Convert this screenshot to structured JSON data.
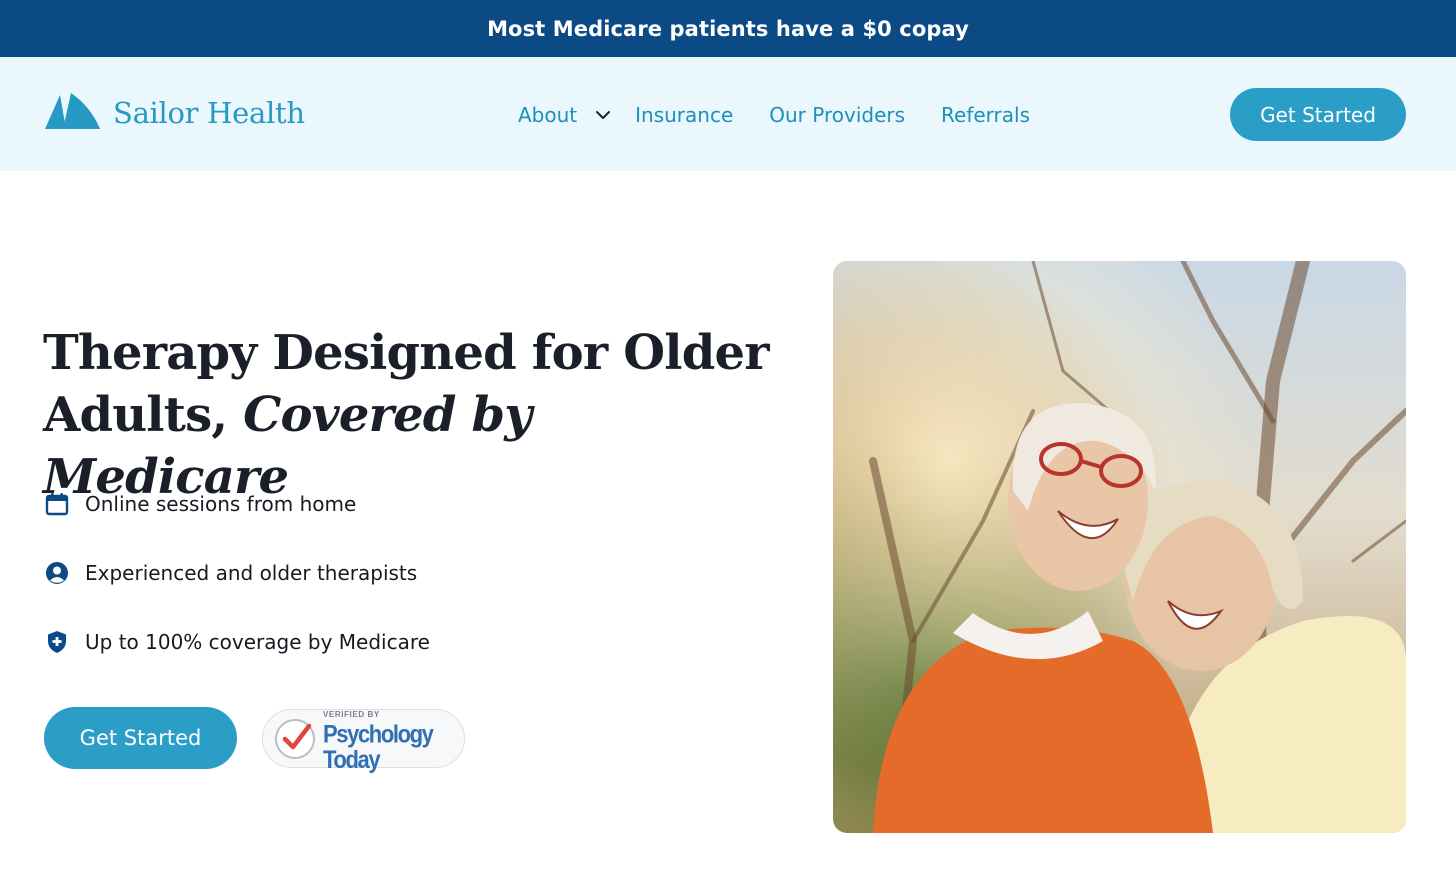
{
  "announcement": {
    "text": "Most Medicare patients have a $0 copay"
  },
  "header": {
    "brand_name": "Sailor Health",
    "logo_icon": "sailboat-icon",
    "nav": [
      {
        "label": "About",
        "has_dropdown": true,
        "icon": "chevron-down-icon"
      },
      {
        "label": "Insurance"
      },
      {
        "label": "Our Providers"
      },
      {
        "label": "Referrals"
      }
    ],
    "cta_label": "Get Started"
  },
  "hero": {
    "title_plain": "Therapy Designed for Older Adults, ",
    "title_italic": "Covered by Medicare",
    "features": [
      {
        "icon": "calendar-icon",
        "text": "Online sessions from home"
      },
      {
        "icon": "user-circle-icon",
        "text": "Experienced and older therapists"
      },
      {
        "icon": "shield-plus-icon",
        "text": "Up to 100% coverage by Medicare"
      }
    ],
    "cta_label": "Get Started",
    "badge": {
      "icon": "check-icon",
      "small_text": "VERIFIED BY",
      "brand_text": "Psychology Today"
    },
    "photo_icon": "hero-photo"
  },
  "colors": {
    "announcement_bg": "#0b4a84",
    "nav_bg": "#eaf7fd",
    "brand_teal": "#2699c4",
    "button_bg": "#2b9ec8",
    "icon_navy": "#0b4a84",
    "heading_text": "#1a1f29"
  }
}
